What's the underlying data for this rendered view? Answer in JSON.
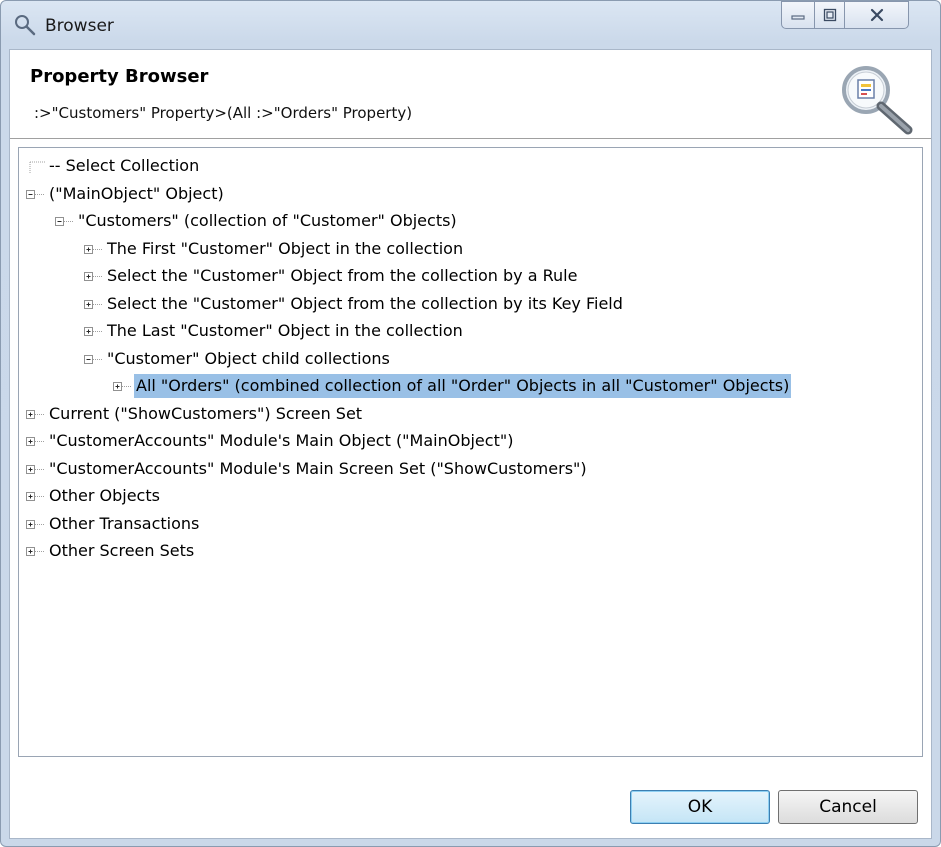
{
  "window": {
    "title": "Browser",
    "icon": "search-icon",
    "controls": {
      "minimize": "minimize-icon",
      "maximize": "maximize-icon",
      "close": "close-icon"
    }
  },
  "header": {
    "title": "Property Browser",
    "path": ":>\"Customers\" Property>(All :>\"Orders\" Property)",
    "logo": "magnifier-logo-icon"
  },
  "tree": {
    "items": [
      {
        "label": "-- Select Collection",
        "level": 0,
        "toggle": "none",
        "selected": false
      },
      {
        "label": "(\"MainObject\" Object)",
        "level": 0,
        "toggle": "minus",
        "selected": false
      },
      {
        "label": "\"Customers\" (collection of \"Customer\" Objects)",
        "level": 1,
        "toggle": "minus",
        "selected": false
      },
      {
        "label": "The First \"Customer\" Object in the collection",
        "level": 2,
        "toggle": "plus",
        "selected": false
      },
      {
        "label": "Select the \"Customer\" Object from the collection by a Rule",
        "level": 2,
        "toggle": "plus",
        "selected": false
      },
      {
        "label": "Select the \"Customer\" Object from the collection by its Key Field",
        "level": 2,
        "toggle": "plus",
        "selected": false
      },
      {
        "label": "The Last \"Customer\" Object in the collection",
        "level": 2,
        "toggle": "plus",
        "selected": false
      },
      {
        "label": "\"Customer\" Object child collections",
        "level": 2,
        "toggle": "minus",
        "selected": false
      },
      {
        "label": "All \"Orders\" (combined collection of all \"Order\" Objects in all \"Customer\" Objects)",
        "level": 3,
        "toggle": "plus",
        "selected": true
      },
      {
        "label": "Current (\"ShowCustomers\") Screen Set",
        "level": 0,
        "toggle": "plus",
        "selected": false
      },
      {
        "label": "\"CustomerAccounts\" Module's Main Object (\"MainObject\")",
        "level": 0,
        "toggle": "plus",
        "selected": false
      },
      {
        "label": "\"CustomerAccounts\" Module's Main Screen Set (\"ShowCustomers\")",
        "level": 0,
        "toggle": "plus",
        "selected": false
      },
      {
        "label": "Other Objects",
        "level": 0,
        "toggle": "plus",
        "selected": false
      },
      {
        "label": "Other Transactions",
        "level": 0,
        "toggle": "plus",
        "selected": false
      },
      {
        "label": "Other Screen Sets",
        "level": 0,
        "toggle": "plus",
        "selected": false
      }
    ]
  },
  "buttons": {
    "ok": "OK",
    "cancel": "Cancel"
  },
  "colors": {
    "selection": "#99c0e6",
    "ok_border": "#3c7fb1"
  }
}
